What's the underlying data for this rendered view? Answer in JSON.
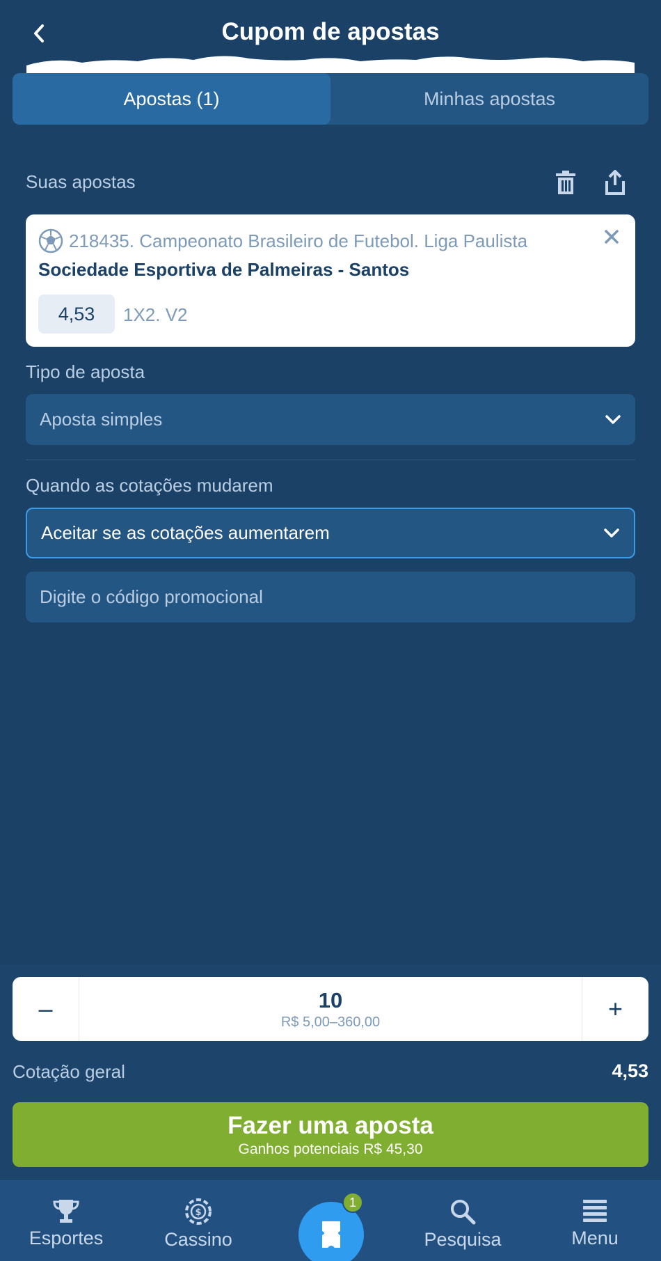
{
  "header": {
    "title": "Cupom de apostas"
  },
  "tabs": [
    {
      "label": "Apostas (1)",
      "active": true
    },
    {
      "label": "Minhas apostas",
      "active": false
    }
  ],
  "bets_section": {
    "label": "Suas apostas"
  },
  "bet": {
    "league": "218435. Campeonato Brasileiro de Futebol. Liga Paulista",
    "teams": "Sociedade Esportiva de Palmeiras - Santos",
    "odds": "4,53",
    "market": "1X2. V2"
  },
  "bet_type": {
    "label": "Tipo de aposta",
    "value": "Aposta simples"
  },
  "odds_change": {
    "label": "Quando as cotações mudarem",
    "value": "Aceitar se as cotações aumentarem"
  },
  "promo": {
    "placeholder": "Digite o código promocional"
  },
  "stake": {
    "minus": "–",
    "value": "10",
    "range": "R$ 5,00–360,00",
    "plus": "+"
  },
  "total_odds": {
    "label": "Cotação geral",
    "value": "4,53"
  },
  "place_bet": {
    "title": "Fazer uma aposta",
    "subtitle": "Ganhos potenciais R$ 45,30"
  },
  "nav": {
    "items": [
      {
        "label": "Esportes",
        "icon": "trophy-icon"
      },
      {
        "label": "Cassino",
        "icon": "casino-chip-icon"
      },
      {
        "label": "Pesquisa",
        "icon": "search-icon"
      },
      {
        "label": "Menu",
        "icon": "menu-icon"
      }
    ],
    "coupon_badge": "1"
  },
  "colors": {
    "background": "#1b4166",
    "accent_green": "#7fae30",
    "accent_blue": "#2f9cf0",
    "field_bg": "#245683"
  }
}
